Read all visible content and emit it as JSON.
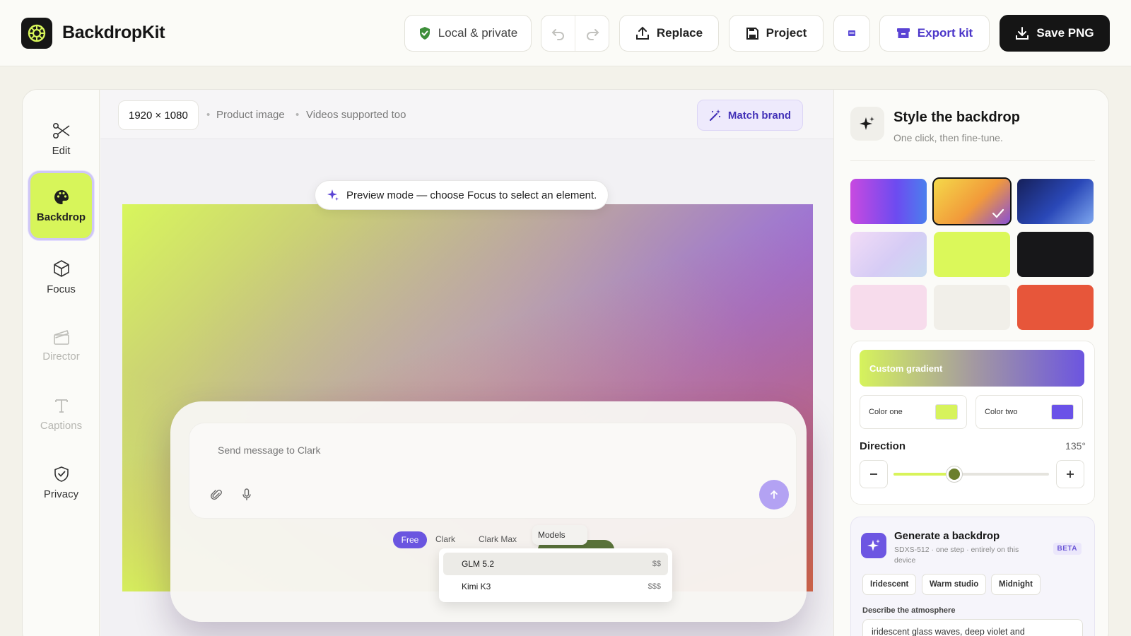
{
  "app": {
    "name": "BackdropKit"
  },
  "toolbar": {
    "local_label": "Local & private",
    "replace_label": "Replace",
    "project_label": "Project",
    "export_label": "Export kit",
    "save_label": "Save PNG"
  },
  "sidebar": {
    "items": [
      {
        "label": "Edit",
        "icon": "scissors-icon",
        "state": "normal"
      },
      {
        "label": "Backdrop",
        "icon": "palette-icon",
        "state": "active"
      },
      {
        "label": "Focus",
        "icon": "cube-icon",
        "state": "normal"
      },
      {
        "label": "Director",
        "icon": "clapperboard-icon",
        "state": "disabled"
      },
      {
        "label": "Captions",
        "icon": "text-icon",
        "state": "disabled"
      },
      {
        "label": "Privacy",
        "icon": "shield-check-icon",
        "state": "normal"
      }
    ]
  },
  "canvas": {
    "dimensions": "1920 × 1080",
    "meta_1": "Product image",
    "meta_2": "Videos supported too",
    "match_brand_label": "Match brand",
    "preview_hint": "Preview mode — choose Focus to select an element."
  },
  "mock_chat": {
    "placeholder": "Send message to Clark",
    "tabs": [
      "Free",
      "Clark",
      "Clark Max"
    ],
    "models_label": "Models",
    "models": [
      {
        "name": "GLM 5.2",
        "price": "$$"
      },
      {
        "name": "Kimi K3",
        "price": "$$$"
      }
    ]
  },
  "panel": {
    "title": "Style the backdrop",
    "subtitle": "One click, then fine-tune.",
    "selected_swatch_index": 1,
    "custom_gradient_label": "Custom gradient",
    "color_one_label": "Color one",
    "color_one": "#D7F35C",
    "color_two_label": "Color two",
    "color_two": "#6A52E8",
    "direction_label": "Direction",
    "direction_value": "135°",
    "direction_fraction": 0.39,
    "generate": {
      "title": "Generate a backdrop",
      "subtitle": "SDXS-512 · one step · entirely on this device",
      "badge": "BETA",
      "presets": [
        "Iridescent",
        "Warm studio",
        "Midnight"
      ],
      "describe_label": "Describe the atmosphere",
      "describe_value": "iridescent glass waves, deep violet and"
    }
  },
  "colors": {
    "accent": "#6A55E0",
    "lime": "#D7F55A",
    "dark": "#151515"
  }
}
